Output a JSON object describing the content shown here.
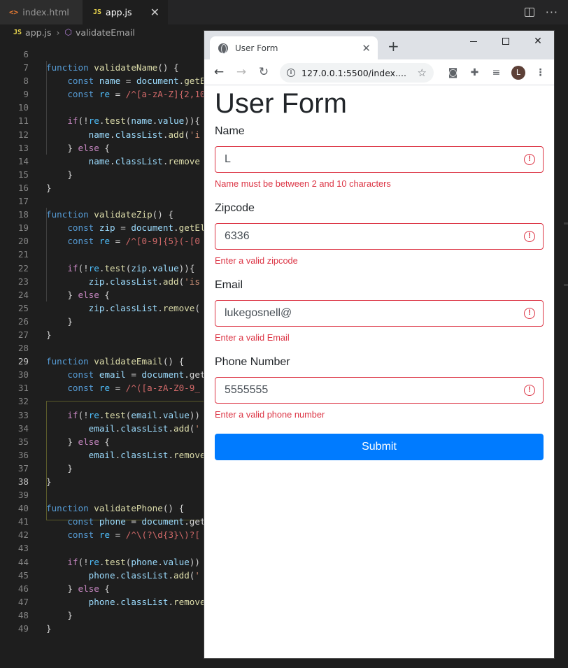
{
  "vscode": {
    "tabs": [
      {
        "icon": "<>",
        "label": "index.html"
      },
      {
        "icon": "JS",
        "label": "app.js"
      }
    ],
    "breadcrumb": {
      "file_icon": "JS",
      "file": "app.js",
      "symbol": "validateEmail"
    },
    "code_lines": [
      {
        "n": "6",
        "t": ""
      },
      {
        "n": "7",
        "t": "function validateName() {"
      },
      {
        "n": "8",
        "t": "    const name = document.getE"
      },
      {
        "n": "9",
        "t": "    const re = /^[a-zA-Z]{2,10"
      },
      {
        "n": "10",
        "t": ""
      },
      {
        "n": "11",
        "t": "    if(!re.test(name.value)){"
      },
      {
        "n": "12",
        "t": "        name.classList.add('i"
      },
      {
        "n": "13",
        "t": "    } else {"
      },
      {
        "n": "14",
        "t": "        name.classList.remove"
      },
      {
        "n": "15",
        "t": "    }"
      },
      {
        "n": "16",
        "t": "}"
      },
      {
        "n": "17",
        "t": ""
      },
      {
        "n": "18",
        "t": "function validateZip() {"
      },
      {
        "n": "19",
        "t": "    const zip = document.getEl"
      },
      {
        "n": "20",
        "t": "    const re = /^[0-9]{5}(-[0"
      },
      {
        "n": "21",
        "t": ""
      },
      {
        "n": "22",
        "t": "    if(!re.test(zip.value)){"
      },
      {
        "n": "23",
        "t": "        zip.classList.add('is"
      },
      {
        "n": "24",
        "t": "    } else {"
      },
      {
        "n": "25",
        "t": "        zip.classList.remove("
      },
      {
        "n": "26",
        "t": "    }"
      },
      {
        "n": "27",
        "t": "}"
      },
      {
        "n": "28",
        "t": ""
      },
      {
        "n": "29",
        "t": "function validateEmail() {"
      },
      {
        "n": "30",
        "t": "    const email = document.get"
      },
      {
        "n": "31",
        "t": "    const re = /^([a-zA-Z0-9_"
      },
      {
        "n": "32",
        "t": ""
      },
      {
        "n": "33",
        "t": "    if(!re.test(email.value))"
      },
      {
        "n": "34",
        "t": "        email.classList.add('"
      },
      {
        "n": "35",
        "t": "    } else {"
      },
      {
        "n": "36",
        "t": "        email.classList.remove"
      },
      {
        "n": "37",
        "t": "    }"
      },
      {
        "n": "38",
        "t": "}"
      },
      {
        "n": "39",
        "t": ""
      },
      {
        "n": "40",
        "t": "function validatePhone() {"
      },
      {
        "n": "41",
        "t": "    const phone = document.get"
      },
      {
        "n": "42",
        "t": "    const re = /^\\(?\\d{3}\\)?["
      },
      {
        "n": "43",
        "t": ""
      },
      {
        "n": "44",
        "t": "    if(!re.test(phone.value))"
      },
      {
        "n": "45",
        "t": "        phone.classList.add('"
      },
      {
        "n": "46",
        "t": "    } else {"
      },
      {
        "n": "47",
        "t": "        phone.classList.remove"
      },
      {
        "n": "48",
        "t": "    }"
      },
      {
        "n": "49",
        "t": "}"
      }
    ]
  },
  "browser": {
    "tab_title": "User Form",
    "url": "127.0.0.1:5500/index....",
    "avatar_letter": "L"
  },
  "form": {
    "heading": "User Form",
    "fields": [
      {
        "label": "Name",
        "value": "L",
        "error": "Name must be between 2 and 10 characters"
      },
      {
        "label": "Zipcode",
        "value": "6336",
        "error": "Enter a valid zipcode"
      },
      {
        "label": "Email",
        "value": "lukegosnell@",
        "error": "Enter a valid Email"
      },
      {
        "label": "Phone Number",
        "value": "5555555",
        "error": "Enter a valid phone number"
      }
    ],
    "submit_label": "Submit"
  },
  "colors": {
    "error": "#dc3545",
    "primary": "#007bff",
    "editor_bg": "#1e1e1e"
  }
}
